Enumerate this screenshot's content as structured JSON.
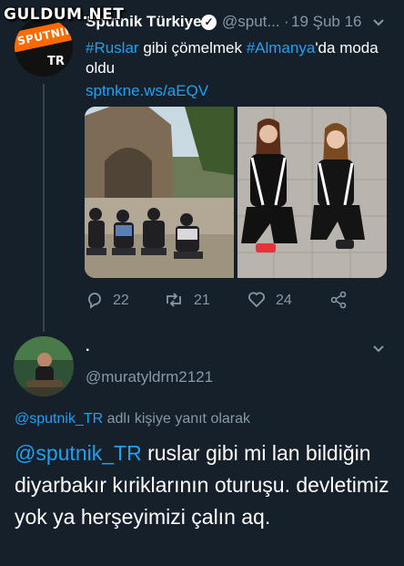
{
  "watermark": "GULDUM.NET",
  "tweet1": {
    "avatar_text_top": "SPUTNIK",
    "avatar_text_bottom": "TR",
    "author_name": "Sputnik Türkiye",
    "handle": "@sput...",
    "separator": "·",
    "date": "19 Şub 16",
    "text_hash1": "#Ruslar",
    "text_mid": " gibi çömelmek ",
    "text_hash2": "#Almanya",
    "text_end": "'da moda oldu",
    "link": "sptnkne.ws/aEQV",
    "reply_count": "22",
    "retweet_count": "21",
    "like_count": "24"
  },
  "tweet2": {
    "author_name": ".",
    "handle": "@muratyldrm2121",
    "reply_to_handle": "@sputnik_TR",
    "reply_to_suffix": " adlı kişiye yanıt olarak",
    "mention": "@sputnik_TR",
    "text": " ruslar gibi mi  lan bildiğin diyarbakır kıriklarının oturuşu. devletimiz yok ya herşeyimizi çalın aq."
  },
  "colors": {
    "background": "#15202b",
    "accent": "#1da1f2",
    "muted": "#8899a6"
  }
}
